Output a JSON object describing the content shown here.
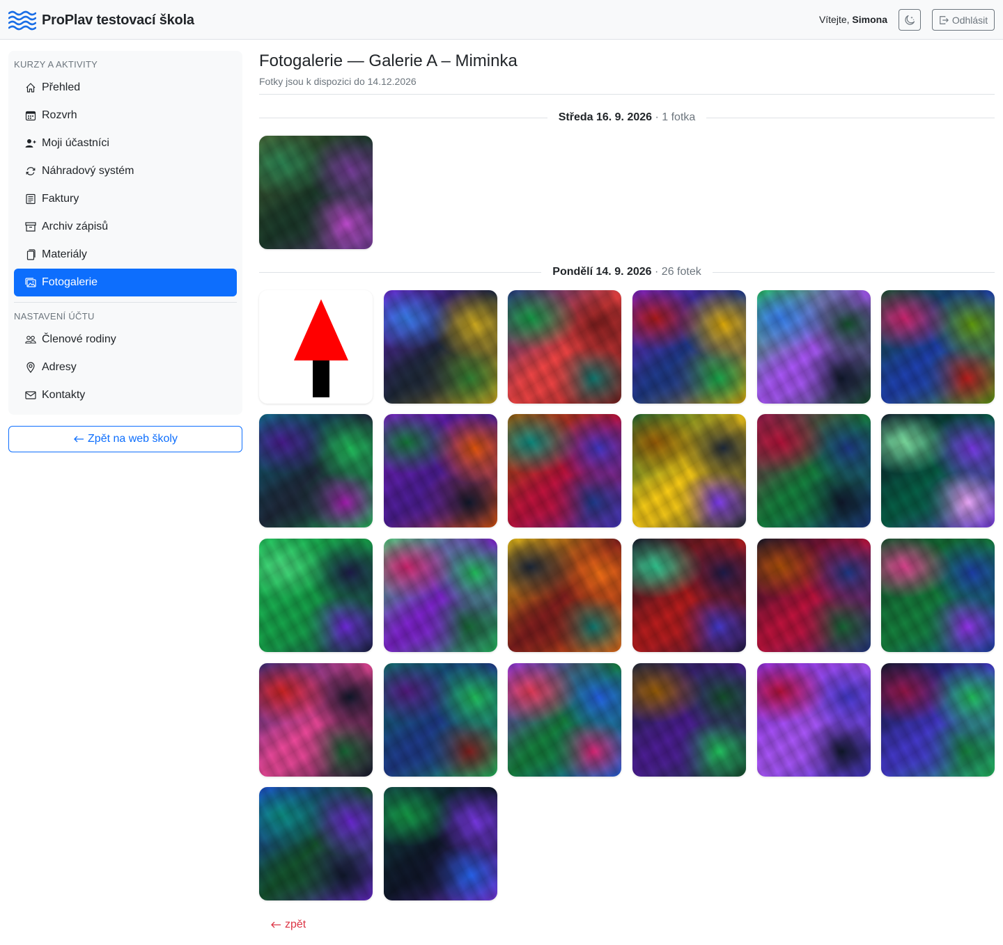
{
  "header": {
    "brand": "ProPlav testovací škola",
    "welcome_prefix": "Vítejte,",
    "user_name": "Simona",
    "logout_label": "Odhlásit"
  },
  "sidebar": {
    "section1_title": "KURZY A AKTIVITY",
    "section1_items": [
      {
        "label": "Přehled",
        "icon": "house-icon"
      },
      {
        "label": "Rozvrh",
        "icon": "calendar-icon"
      },
      {
        "label": "Moji účastníci",
        "icon": "person-plus-icon"
      },
      {
        "label": "Náhradový systém",
        "icon": "arrow-repeat-icon"
      },
      {
        "label": "Faktury",
        "icon": "document-list-icon"
      },
      {
        "label": "Archiv zápisů",
        "icon": "archive-icon"
      },
      {
        "label": "Materiály",
        "icon": "files-icon"
      },
      {
        "label": "Fotogalerie",
        "icon": "images-icon",
        "active": true
      }
    ],
    "section2_title": "NASTAVENÍ ÚČTU",
    "section2_items": [
      {
        "label": "Členové rodiny",
        "icon": "people-icon"
      },
      {
        "label": "Adresy",
        "icon": "geo-pin-icon"
      },
      {
        "label": "Kontakty",
        "icon": "envelope-icon"
      }
    ],
    "back_button": "Zpět na web školy"
  },
  "main": {
    "title": "Fotogalerie — Galerie A – Miminka",
    "subtitle": "Fotky jsou k dispozici do 14.12.2026",
    "days": [
      {
        "date": "Středa 16. 9. 2026",
        "count": "· 1 fotka",
        "photos": 1
      },
      {
        "date": "Pondělí 14. 9. 2026",
        "count": "· 26 fotek",
        "photos": 26
      }
    ],
    "back_link": "zpět"
  },
  "colors": {
    "accent": "#0d6efd",
    "danger": "#dc3545",
    "muted": "#6c757d",
    "sidebar_bg": "#f8f9fa",
    "topbar_bg": "#f8f9fa"
  }
}
